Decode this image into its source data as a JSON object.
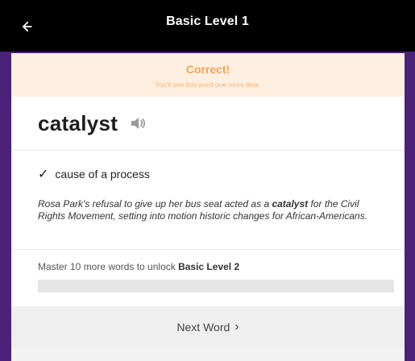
{
  "header": {
    "title": "Basic Level 1",
    "back_icon": "arrow-left-icon"
  },
  "feedback": {
    "title": "Correct!",
    "subtitle": "You'll see this word one more time."
  },
  "word": {
    "text": "catalyst",
    "audio_icon": "speaker-icon"
  },
  "definition": {
    "check_icon": "✓",
    "text": "cause of a process"
  },
  "example": {
    "before": "Rosa Park's refusal to give up her bus seat acted as a ",
    "highlight": "catalyst",
    "after": " for the Civil Rights Movement, setting into motion historic changes for African-Americans."
  },
  "progress": {
    "label_before": "Master 10 more words to unlock ",
    "label_strong": "Basic Level 2",
    "value": 0
  },
  "actions": {
    "next_label": "Next Word",
    "next_icon": "›"
  },
  "colors": {
    "header": "#000000",
    "frame": "#4b2278",
    "success": "#f0a45b",
    "success_bg": "#ffefe1"
  }
}
